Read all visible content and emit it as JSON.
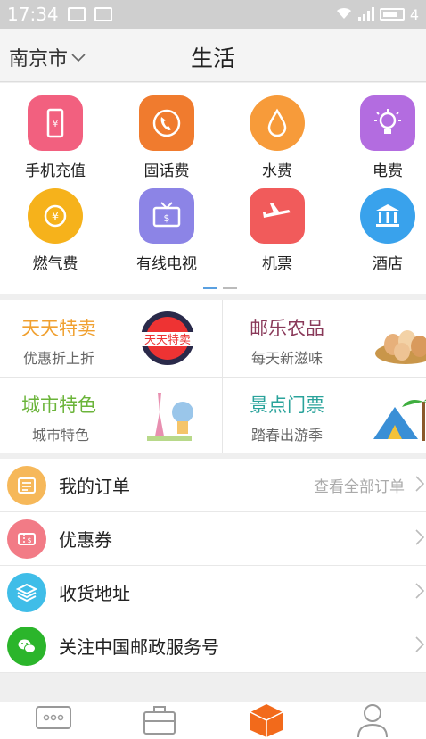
{
  "statusbar": {
    "time": "17:34",
    "battery_label": "4"
  },
  "header": {
    "city": "南京市",
    "title": "生活"
  },
  "services": [
    {
      "label": "手机充值",
      "icon": "phone-recharge-icon",
      "color": "#f2607f"
    },
    {
      "label": "固话费",
      "icon": "telephone-icon",
      "color": "#f07b2e"
    },
    {
      "label": "水费",
      "icon": "water-drop-icon",
      "color": "#f79b3a"
    },
    {
      "label": "电费",
      "icon": "light-bulb-icon",
      "color": "#b36ce0"
    },
    {
      "label": "燃气费",
      "icon": "gas-coin-icon",
      "color": "#f6b21b"
    },
    {
      "label": "有线电视",
      "icon": "tv-icon",
      "color": "#8c84e6"
    },
    {
      "label": "机票",
      "icon": "airplane-icon",
      "color": "#f15b5b"
    },
    {
      "label": "酒店",
      "icon": "hotel-icon",
      "color": "#39a2ec"
    }
  ],
  "promos": [
    {
      "title": "天天特卖",
      "subtitle": "优惠折上折",
      "color": "#f0a030",
      "art_text": "天天特卖"
    },
    {
      "title": "邮乐农品",
      "subtitle": "每天新滋味",
      "color": "#8a3a5a"
    },
    {
      "title": "城市特色",
      "subtitle": "城市特色",
      "color": "#6bb43a"
    },
    {
      "title": "景点门票",
      "subtitle": "踏春出游季",
      "color": "#2aa39b"
    }
  ],
  "menu": [
    {
      "label": "我的订单",
      "extra": "查看全部订单",
      "icon": "order-list-icon",
      "color": "#f6b85a"
    },
    {
      "label": "优惠券",
      "extra": "",
      "icon": "coupon-icon",
      "color": "#f27b86"
    },
    {
      "label": "收货地址",
      "extra": "",
      "icon": "address-layers-icon",
      "color": "#3fbde8"
    },
    {
      "label": "关注中国邮政服务号",
      "extra": "",
      "icon": "wechat-icon",
      "color": "#2bb52b"
    }
  ],
  "tabs": [
    {
      "icon": "message-icon"
    },
    {
      "icon": "briefcase-icon"
    },
    {
      "icon": "package-box-icon",
      "active_color": "#f26a1b"
    },
    {
      "icon": "user-icon"
    }
  ]
}
